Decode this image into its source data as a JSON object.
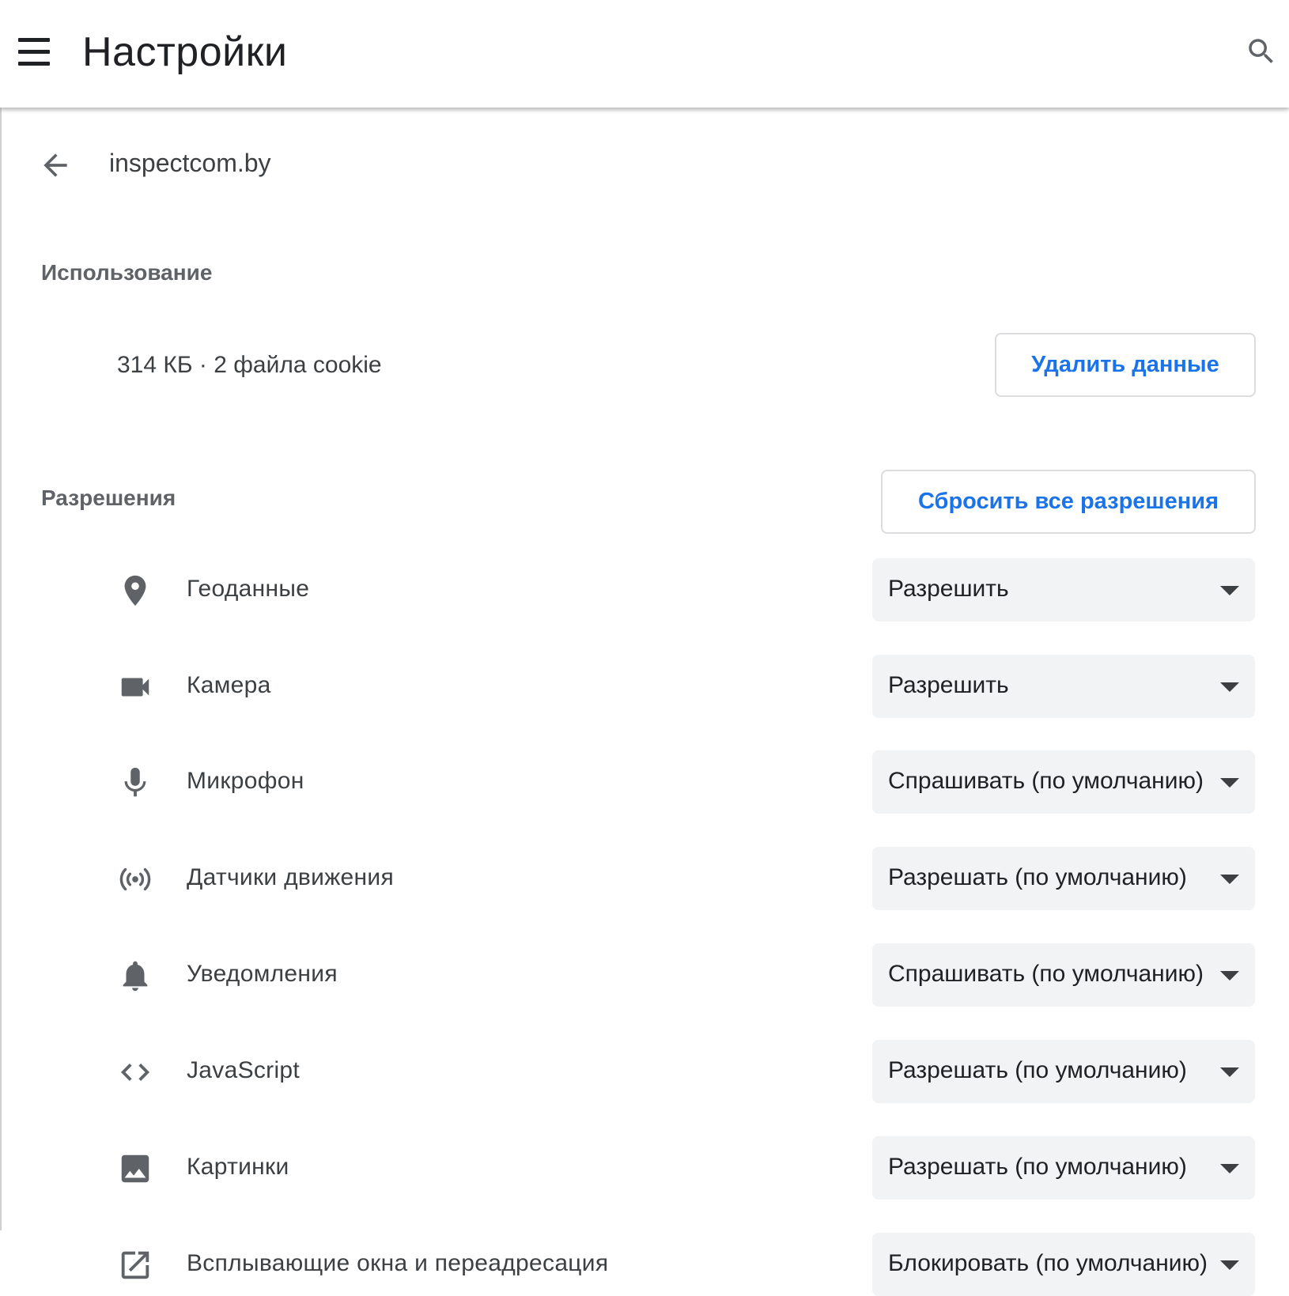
{
  "header": {
    "title": "Настройки",
    "menu_icon": "hamburger-menu-icon",
    "search_icon": "search-icon"
  },
  "site": {
    "back_icon": "arrow-back-icon",
    "name": "inspectcom.by"
  },
  "usage": {
    "heading": "Использование",
    "summary": "314 КБ · 2 файла cookie",
    "clear_button": "Удалить данные"
  },
  "permissions": {
    "heading": "Разрешения",
    "reset_button": "Сбросить все разрешения",
    "items": [
      {
        "icon": "location-pin-icon",
        "label": "Геоданные",
        "value": "Разрешить"
      },
      {
        "icon": "camera-icon",
        "label": "Камера",
        "value": "Разрешить"
      },
      {
        "icon": "microphone-icon",
        "label": "Микрофон",
        "value": "Спрашивать (по умолчанию)"
      },
      {
        "icon": "motion-sensors-icon",
        "label": "Датчики движения",
        "value": "Разрешать (по умолчанию)"
      },
      {
        "icon": "bell-icon",
        "label": "Уведомления",
        "value": "Спрашивать (по умолчанию)"
      },
      {
        "icon": "code-icon",
        "label": "JavaScript",
        "value": "Разрешать (по умолчанию)"
      },
      {
        "icon": "image-icon",
        "label": "Картинки",
        "value": "Разрешать (по умолчанию)"
      },
      {
        "icon": "open-in-new-icon",
        "label": "Всплывающие окна и переадресация",
        "value": "Блокировать (по умолчанию)"
      }
    ]
  },
  "colors": {
    "accent": "#1a73e8",
    "text_primary": "#202124",
    "text_secondary": "#3c4043",
    "section_heading": "#5f6368",
    "select_background": "#f1f3f4",
    "button_border": "#dadce0"
  }
}
